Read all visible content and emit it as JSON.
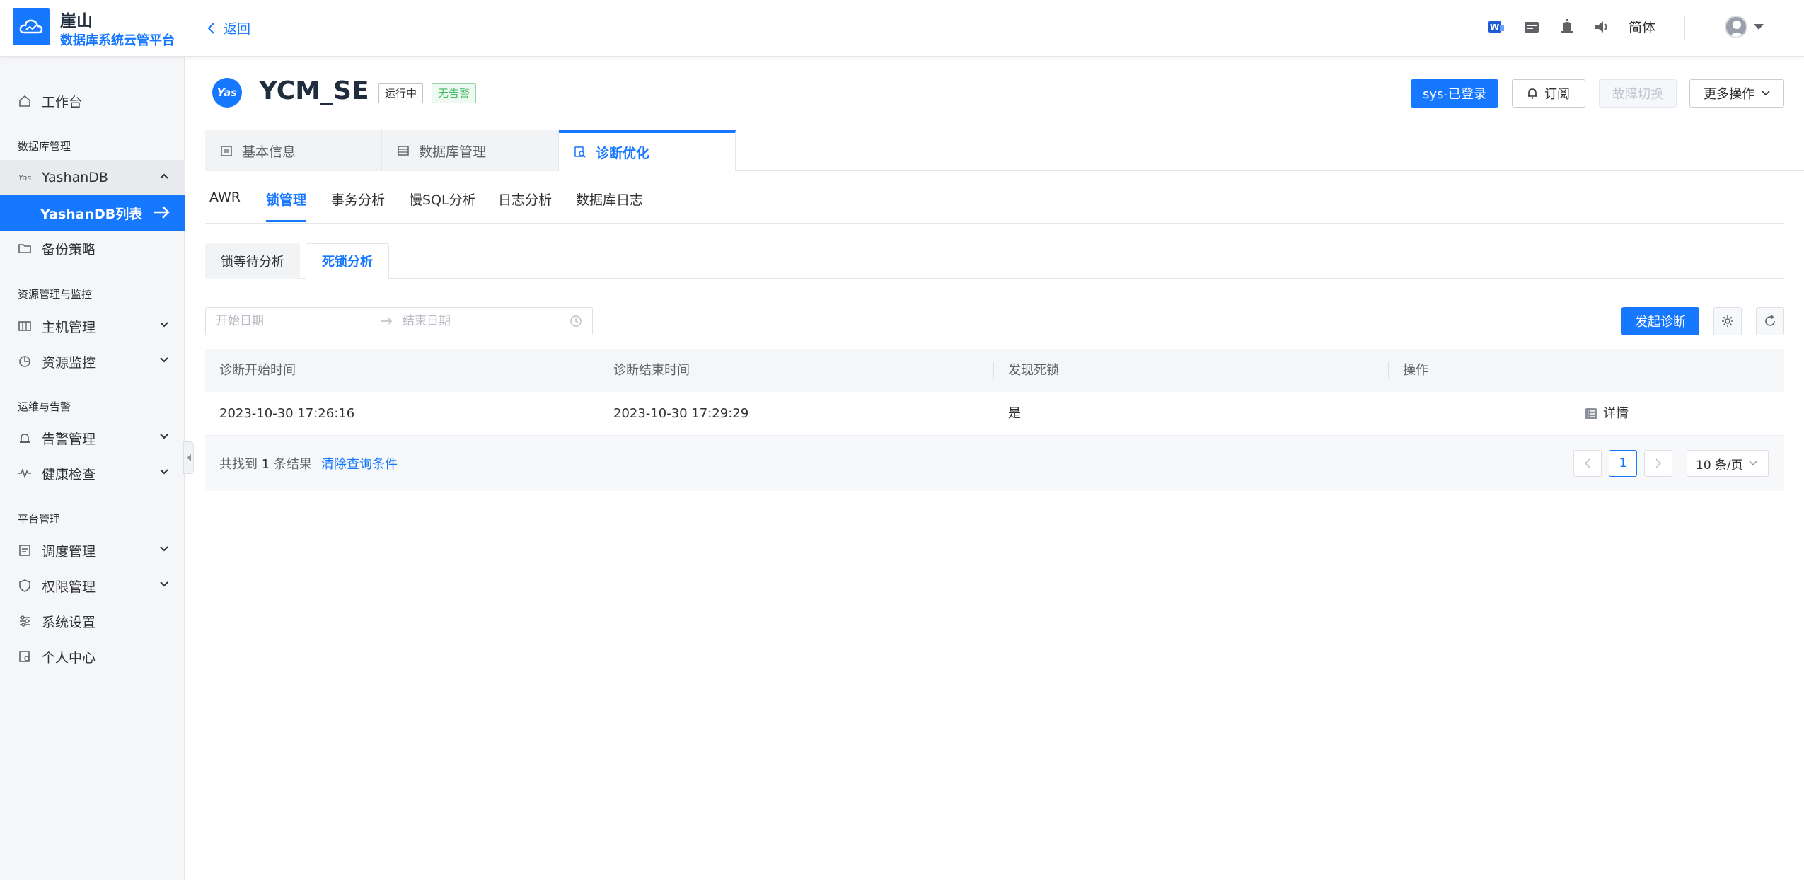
{
  "header": {
    "brand_title": "崖山",
    "brand_subtitle": "数据库系统云管平台",
    "back_label": "返回",
    "language": "简体",
    "icons": [
      "word-icon",
      "clipboard-icon",
      "alarm-icon",
      "speaker-icon"
    ]
  },
  "sidebar": {
    "workbench": "工作台",
    "group_db": "数据库管理",
    "yashandb": "YashanDB",
    "yashandb_list": "YashanDB列表",
    "backup": "备份策略",
    "group_resource": "资源管理与监控",
    "host_mgmt": "主机管理",
    "resource_monitor": "资源监控",
    "group_ops": "运维与告警",
    "alarm_mgmt": "告警管理",
    "health_check": "健康检查",
    "group_platform": "平台管理",
    "schedule_mgmt": "调度管理",
    "perm_mgmt": "权限管理",
    "system_settings": "系统设置",
    "personal_center": "个人中心"
  },
  "instance": {
    "logo_text": "Yas",
    "name": "YCM_SE",
    "status_tag": "运行中",
    "alarm_tag": "无告警",
    "actions": {
      "login": "sys-已登录",
      "subscribe": "订阅",
      "failover": "故障切换",
      "more": "更多操作"
    }
  },
  "tabs_main": [
    {
      "label": "基本信息"
    },
    {
      "label": "数据库管理"
    },
    {
      "label": "诊断优化"
    }
  ],
  "tabs_sub": [
    {
      "label": "AWR"
    },
    {
      "label": "锁管理"
    },
    {
      "label": "事务分析"
    },
    {
      "label": "慢SQL分析"
    },
    {
      "label": "日志分析"
    },
    {
      "label": "数据库日志"
    }
  ],
  "tabs_lock": [
    {
      "label": "锁等待分析"
    },
    {
      "label": "死锁分析"
    }
  ],
  "filter": {
    "start_placeholder": "开始日期",
    "end_placeholder": "结束日期",
    "diagnose_button": "发起诊断"
  },
  "table": {
    "columns": [
      "诊断开始时间",
      "诊断结束时间",
      "发现死锁",
      "操作"
    ],
    "rows": [
      {
        "start": "2023-10-30 17:26:16",
        "end": "2023-10-30 17:29:29",
        "deadlock": "是",
        "action": "详情"
      }
    ]
  },
  "footer": {
    "result_prefix": "共找到",
    "result_count": "1",
    "result_suffix": "条结果",
    "clear_label": "清除查询条件",
    "current_page": "1",
    "page_size": "10 条/页"
  },
  "colors": {
    "primary": "#1677ff",
    "success": "#3dbb63",
    "sidebar_bg": "#f5f6f8"
  }
}
